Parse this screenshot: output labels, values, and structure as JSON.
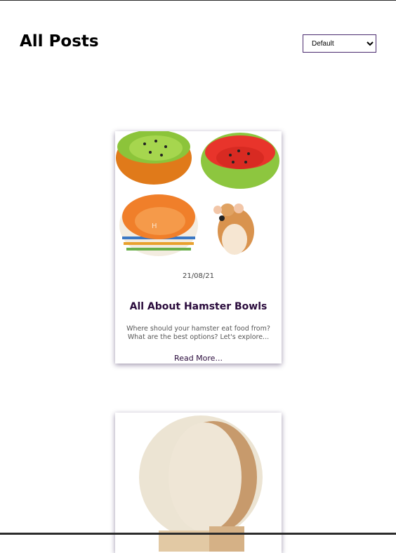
{
  "page": {
    "title": "All Posts"
  },
  "sort": {
    "selected": "Default",
    "options": [
      "Default"
    ]
  },
  "posts": [
    {
      "date": "21/08/21",
      "title": "All About Hamster Bowls",
      "excerpt": "Where should your hamster eat food from? What are the best options? Let's explore...",
      "read_more": "Read More...",
      "image_icon": "hamster-bowls-image"
    },
    {
      "image_icon": "hamster-wheel-image"
    }
  ]
}
